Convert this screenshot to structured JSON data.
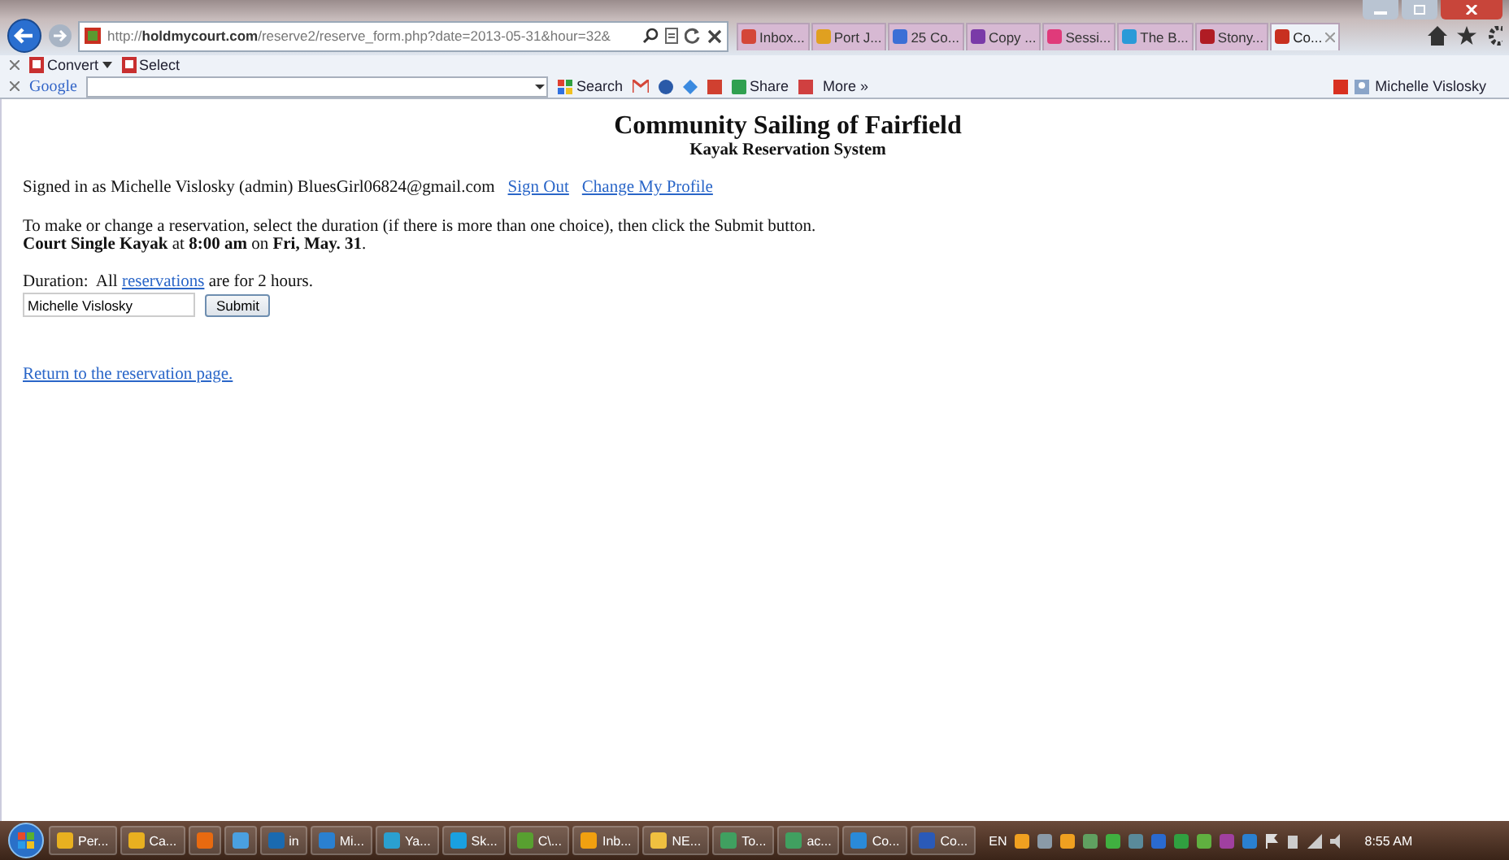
{
  "browser": {
    "url": "http://**holdmycourt.com**/reserve2/reserve_form.php?date=2013-05-31&hour=32&",
    "tabs": [
      {
        "label": "Inbox...",
        "selected": false,
        "color": "#d44638"
      },
      {
        "label": "Port J...",
        "selected": false,
        "color": "#e0a020"
      },
      {
        "label": "25 Co...",
        "selected": false,
        "color": "#3b6fd6"
      },
      {
        "label": "Copy ...",
        "selected": false,
        "color": "#7a3aa8"
      },
      {
        "label": "Sessi...",
        "selected": false,
        "color": "#e03a7a"
      },
      {
        "label": "The B...",
        "selected": false,
        "color": "#2a9ad8"
      },
      {
        "label": "Stony...",
        "selected": false,
        "color": "#b01c24"
      },
      {
        "label": "Co...",
        "selected": true,
        "color": "#c83020"
      }
    ],
    "toolbar": [
      "Convert",
      "Select"
    ],
    "google_toolbar": {
      "brand": "Google",
      "search": "Search",
      "share": "Share",
      "more": "More »",
      "user": "Michelle Vislosky"
    }
  },
  "page": {
    "title": "Community Sailing of Fairfield",
    "subtitle": "Kayak Reservation System",
    "signed_in": "Signed in as Michelle Vislosky (admin) BluesGirl06824@gmail.com",
    "links": [
      "Sign Out",
      "Change My Profile"
    ],
    "instructions": "To make or change a reservation, select the duration (if there is more than one choice), then click the Submit button.",
    "details": "**Court Single Kayak** at **8:00 am** on **Fri, May. 31**.",
    "duration": {
      "label": "Duration:  All ",
      "link": "reservations",
      "rest": " are for 2 hours."
    },
    "name_field": {
      "value": "Michelle Vislosky"
    },
    "submit": "Submit",
    "return_link": "Return to the reservation page."
  },
  "taskbar": {
    "items": [
      {
        "label": "Per...",
        "color": "#e8b020"
      },
      {
        "label": "Ca...",
        "color": "#e8b020"
      },
      {
        "color": "#e86a10"
      },
      {
        "color": "#4aa0e0"
      },
      {
        "label": "in",
        "color": "#1a6ab0"
      },
      {
        "label": "Mi...",
        "color": "#2a80d0"
      },
      {
        "label": "Ya...",
        "color": "#2aa0d0"
      },
      {
        "label": "Sk...",
        "color": "#1aa0e0"
      },
      {
        "label": "C\\...",
        "color": "#58a030"
      },
      {
        "label": "Inb...",
        "color": "#f0a010"
      },
      {
        "label": "NE...",
        "color": "#f0c040"
      },
      {
        "label": "To...",
        "color": "#40a060"
      },
      {
        "label": "ac...",
        "color": "#40a060"
      },
      {
        "label": "Co...",
        "color": "#2a8ad8"
      },
      {
        "label": "Co...",
        "color": "#2a5ab8"
      }
    ],
    "language": "EN",
    "clock": "8:55 AM"
  }
}
